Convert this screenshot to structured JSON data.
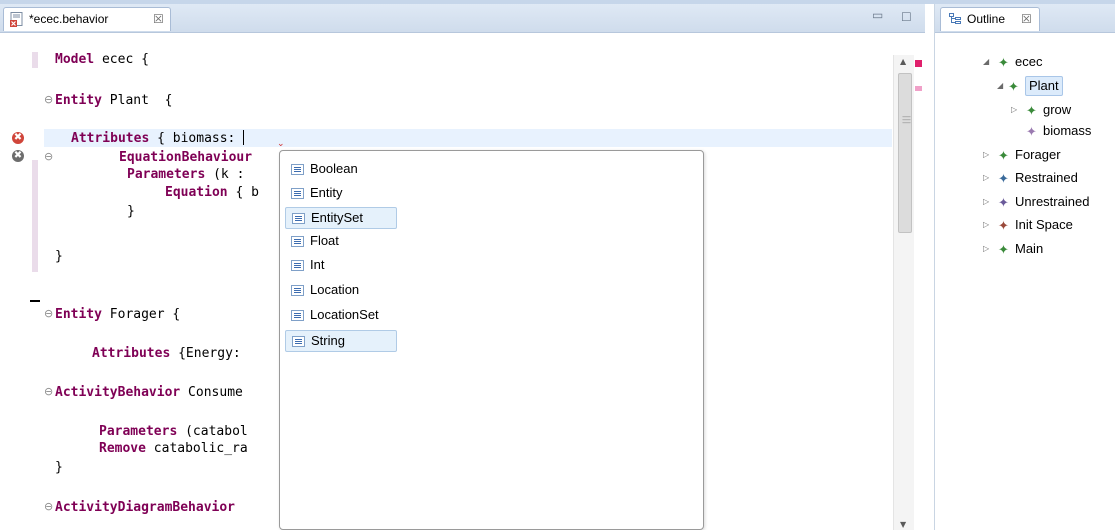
{
  "editor": {
    "tab_title": "*ecec.behavior",
    "tab_close": "☒",
    "min_glyph": "▭",
    "max_glyph": "☐",
    "lines": [
      {
        "parts": [
          {
            "t": "Model",
            "kw": true
          },
          {
            "t": " ecec {",
            "kw": false
          }
        ]
      },
      {
        "parts": [
          {
            "t": "Entity",
            "kw": true
          },
          {
            "t": " Plant  {",
            "kw": false
          }
        ]
      },
      {
        "parts": [
          {
            "t": "Attributes",
            "kw": true
          },
          {
            "t": " { biomass: ",
            "kw": false
          }
        ]
      },
      {
        "parts": [
          {
            "t": "EquationBehaviour",
            "kw": true
          }
        ]
      },
      {
        "parts": [
          {
            "t": "Parameters",
            "kw": true
          },
          {
            "t": " (k : ",
            "kw": false
          }
        ]
      },
      {
        "parts": [
          {
            "t": "Equation",
            "kw": true
          },
          {
            "t": " { b",
            "kw": false
          }
        ]
      },
      {
        "parts": [
          {
            "t": "}",
            "kw": false
          }
        ]
      },
      {
        "parts": [
          {
            "t": "}",
            "kw": false
          }
        ]
      },
      {
        "parts": [
          {
            "t": "Entity",
            "kw": true
          },
          {
            "t": " Forager {",
            "kw": false
          }
        ]
      },
      {
        "parts": [
          {
            "t": "Attributes",
            "kw": true
          },
          {
            "t": " {Energy: ",
            "kw": false
          }
        ]
      },
      {
        "parts": [
          {
            "t": "ActivityBehavior",
            "kw": true
          },
          {
            "t": " Consume",
            "kw": false
          }
        ]
      },
      {
        "parts": [
          {
            "t": "Parameters",
            "kw": true
          },
          {
            "t": " (catabol",
            "kw": false
          }
        ]
      },
      {
        "parts": [
          {
            "t": "Remove",
            "kw": true
          },
          {
            "t": " catabolic_ra",
            "kw": false
          }
        ]
      },
      {
        "parts": [
          {
            "t": "}",
            "kw": false
          }
        ]
      },
      {
        "parts": [
          {
            "t": "ActivityDiagramBehavior",
            "kw": true
          }
        ]
      }
    ],
    "fold_glyph": "⊖",
    "error_glyph": "✖",
    "error_color": "#d0453a",
    "warn_color": "#6d6d6d",
    "overview_error_color": "#e0206c"
  },
  "assist": {
    "proposals": [
      "Boolean",
      "Entity",
      "EntitySet",
      "Float",
      "Int",
      "Location",
      "LocationSet",
      "String"
    ],
    "highlighted": [
      "EntitySet",
      "String"
    ]
  },
  "outline": {
    "tab_title": "Outline",
    "tab_close": "☒",
    "items": [
      {
        "label": "ecec",
        "twisty": "◢",
        "node_color": "#3a8a3a"
      },
      {
        "label": "Plant",
        "twisty": "◢",
        "node_color": "#3a8a3a",
        "selected": true
      },
      {
        "label": "grow",
        "twisty": "▷",
        "node_color": "#3a8a3a"
      },
      {
        "label": "biomass",
        "twisty": "",
        "node_color": "#9a7ab0"
      },
      {
        "label": "Forager",
        "twisty": "▷",
        "node_color": "#3a8a3a"
      },
      {
        "label": "Restrained",
        "twisty": "▷",
        "node_color": "#3a6a9a"
      },
      {
        "label": "Unrestrained",
        "twisty": "▷",
        "node_color": "#6a5a9a"
      },
      {
        "label": "Init Space",
        "twisty": "▷",
        "node_color": "#9a4a3a"
      },
      {
        "label": "Main",
        "twisty": "▷",
        "node_color": "#3a8a3a"
      }
    ],
    "node_glyph": "✦"
  }
}
